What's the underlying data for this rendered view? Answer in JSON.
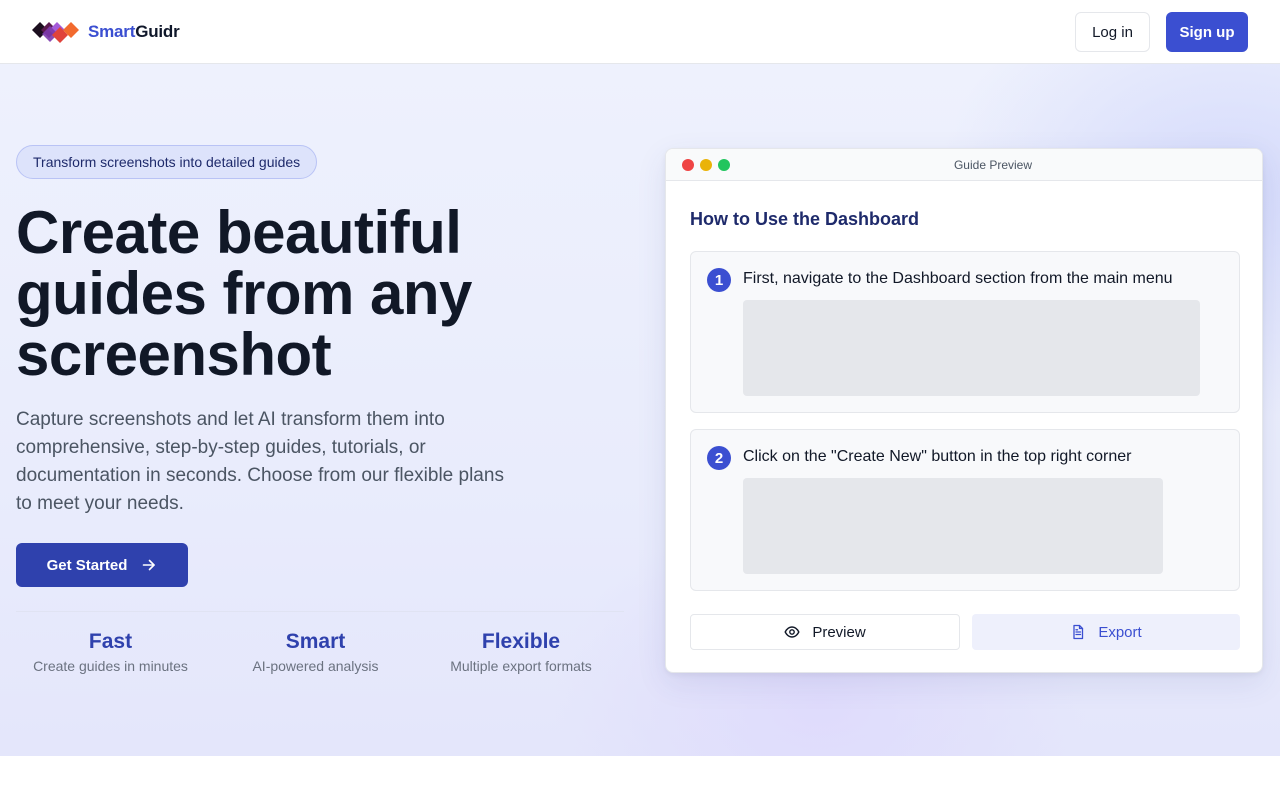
{
  "header": {
    "logo_icon": "smartguidr-logo-icon",
    "brand_part1": "Smart",
    "brand_part2": "Guidr",
    "login_label": "Log in",
    "signup_label": "Sign up"
  },
  "hero": {
    "badge": "Transform screenshots into detailed guides",
    "headline_lines": [
      "Create beautiful",
      "guides from any",
      "screenshot"
    ],
    "subtext_lines": [
      "Capture screenshots and let AI transform them into",
      "comprehensive, step-by-step guides, tutorials, or",
      "documentation in seconds. Choose from our flexible plans",
      "to meet your needs."
    ],
    "cta_label": "Get Started",
    "cta_icon": "arrow-right-icon",
    "features": [
      {
        "title": "Fast",
        "desc": "Create guides in minutes"
      },
      {
        "title": "Smart",
        "desc": "AI-powered analysis"
      },
      {
        "title": "Flexible",
        "desc": "Multiple export formats"
      }
    ]
  },
  "preview": {
    "window_title": "Guide Preview",
    "guide_title": "How to Use the Dashboard",
    "steps": [
      {
        "number": "1",
        "text": "First, navigate to the Dashboard section from the main menu"
      },
      {
        "number": "2",
        "text": "Click on the \"Create New\" button in the top right corner"
      }
    ],
    "preview_label": "Preview",
    "preview_icon": "eye-icon",
    "export_label": "Export",
    "export_icon": "document-icon"
  },
  "colors": {
    "brand": "#3b4fd1",
    "brand_dark": "#2f41ad",
    "headline": "#111827",
    "traffic_red": "#ef4444",
    "traffic_yellow": "#eab308",
    "traffic_green": "#22c55e"
  }
}
